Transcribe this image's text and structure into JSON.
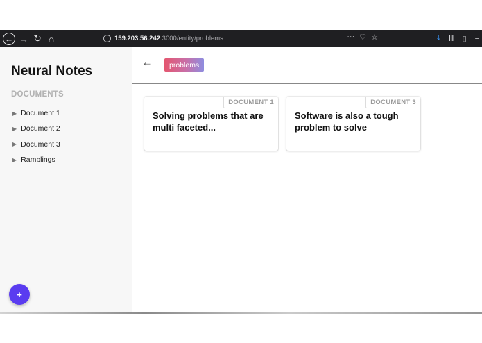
{
  "browser": {
    "back_icon": "back-arrow-icon",
    "forward_icon": "forward-arrow-icon",
    "reload_icon": "reload-icon",
    "home_icon": "home-icon",
    "url_host": "159.203.56.242",
    "url_path": ":3000/entity/problems",
    "accent_download": "#3d9bff"
  },
  "sidebar": {
    "title": "Neural Notes",
    "section_label": "DOCUMENTS",
    "items": [
      {
        "label": "Document 1"
      },
      {
        "label": "Document 2"
      },
      {
        "label": "Document 3"
      },
      {
        "label": "Ramblings"
      }
    ],
    "fab_label": "+",
    "fab_color": "#5a3cf0"
  },
  "main": {
    "back_label": "←",
    "tag_label": "problems",
    "cards": [
      {
        "source": "DOCUMENT 1",
        "text": "Solving problems that are multi faceted..."
      },
      {
        "source": "DOCUMENT 3",
        "text": "Software is also a tough problem to solve"
      }
    ]
  }
}
